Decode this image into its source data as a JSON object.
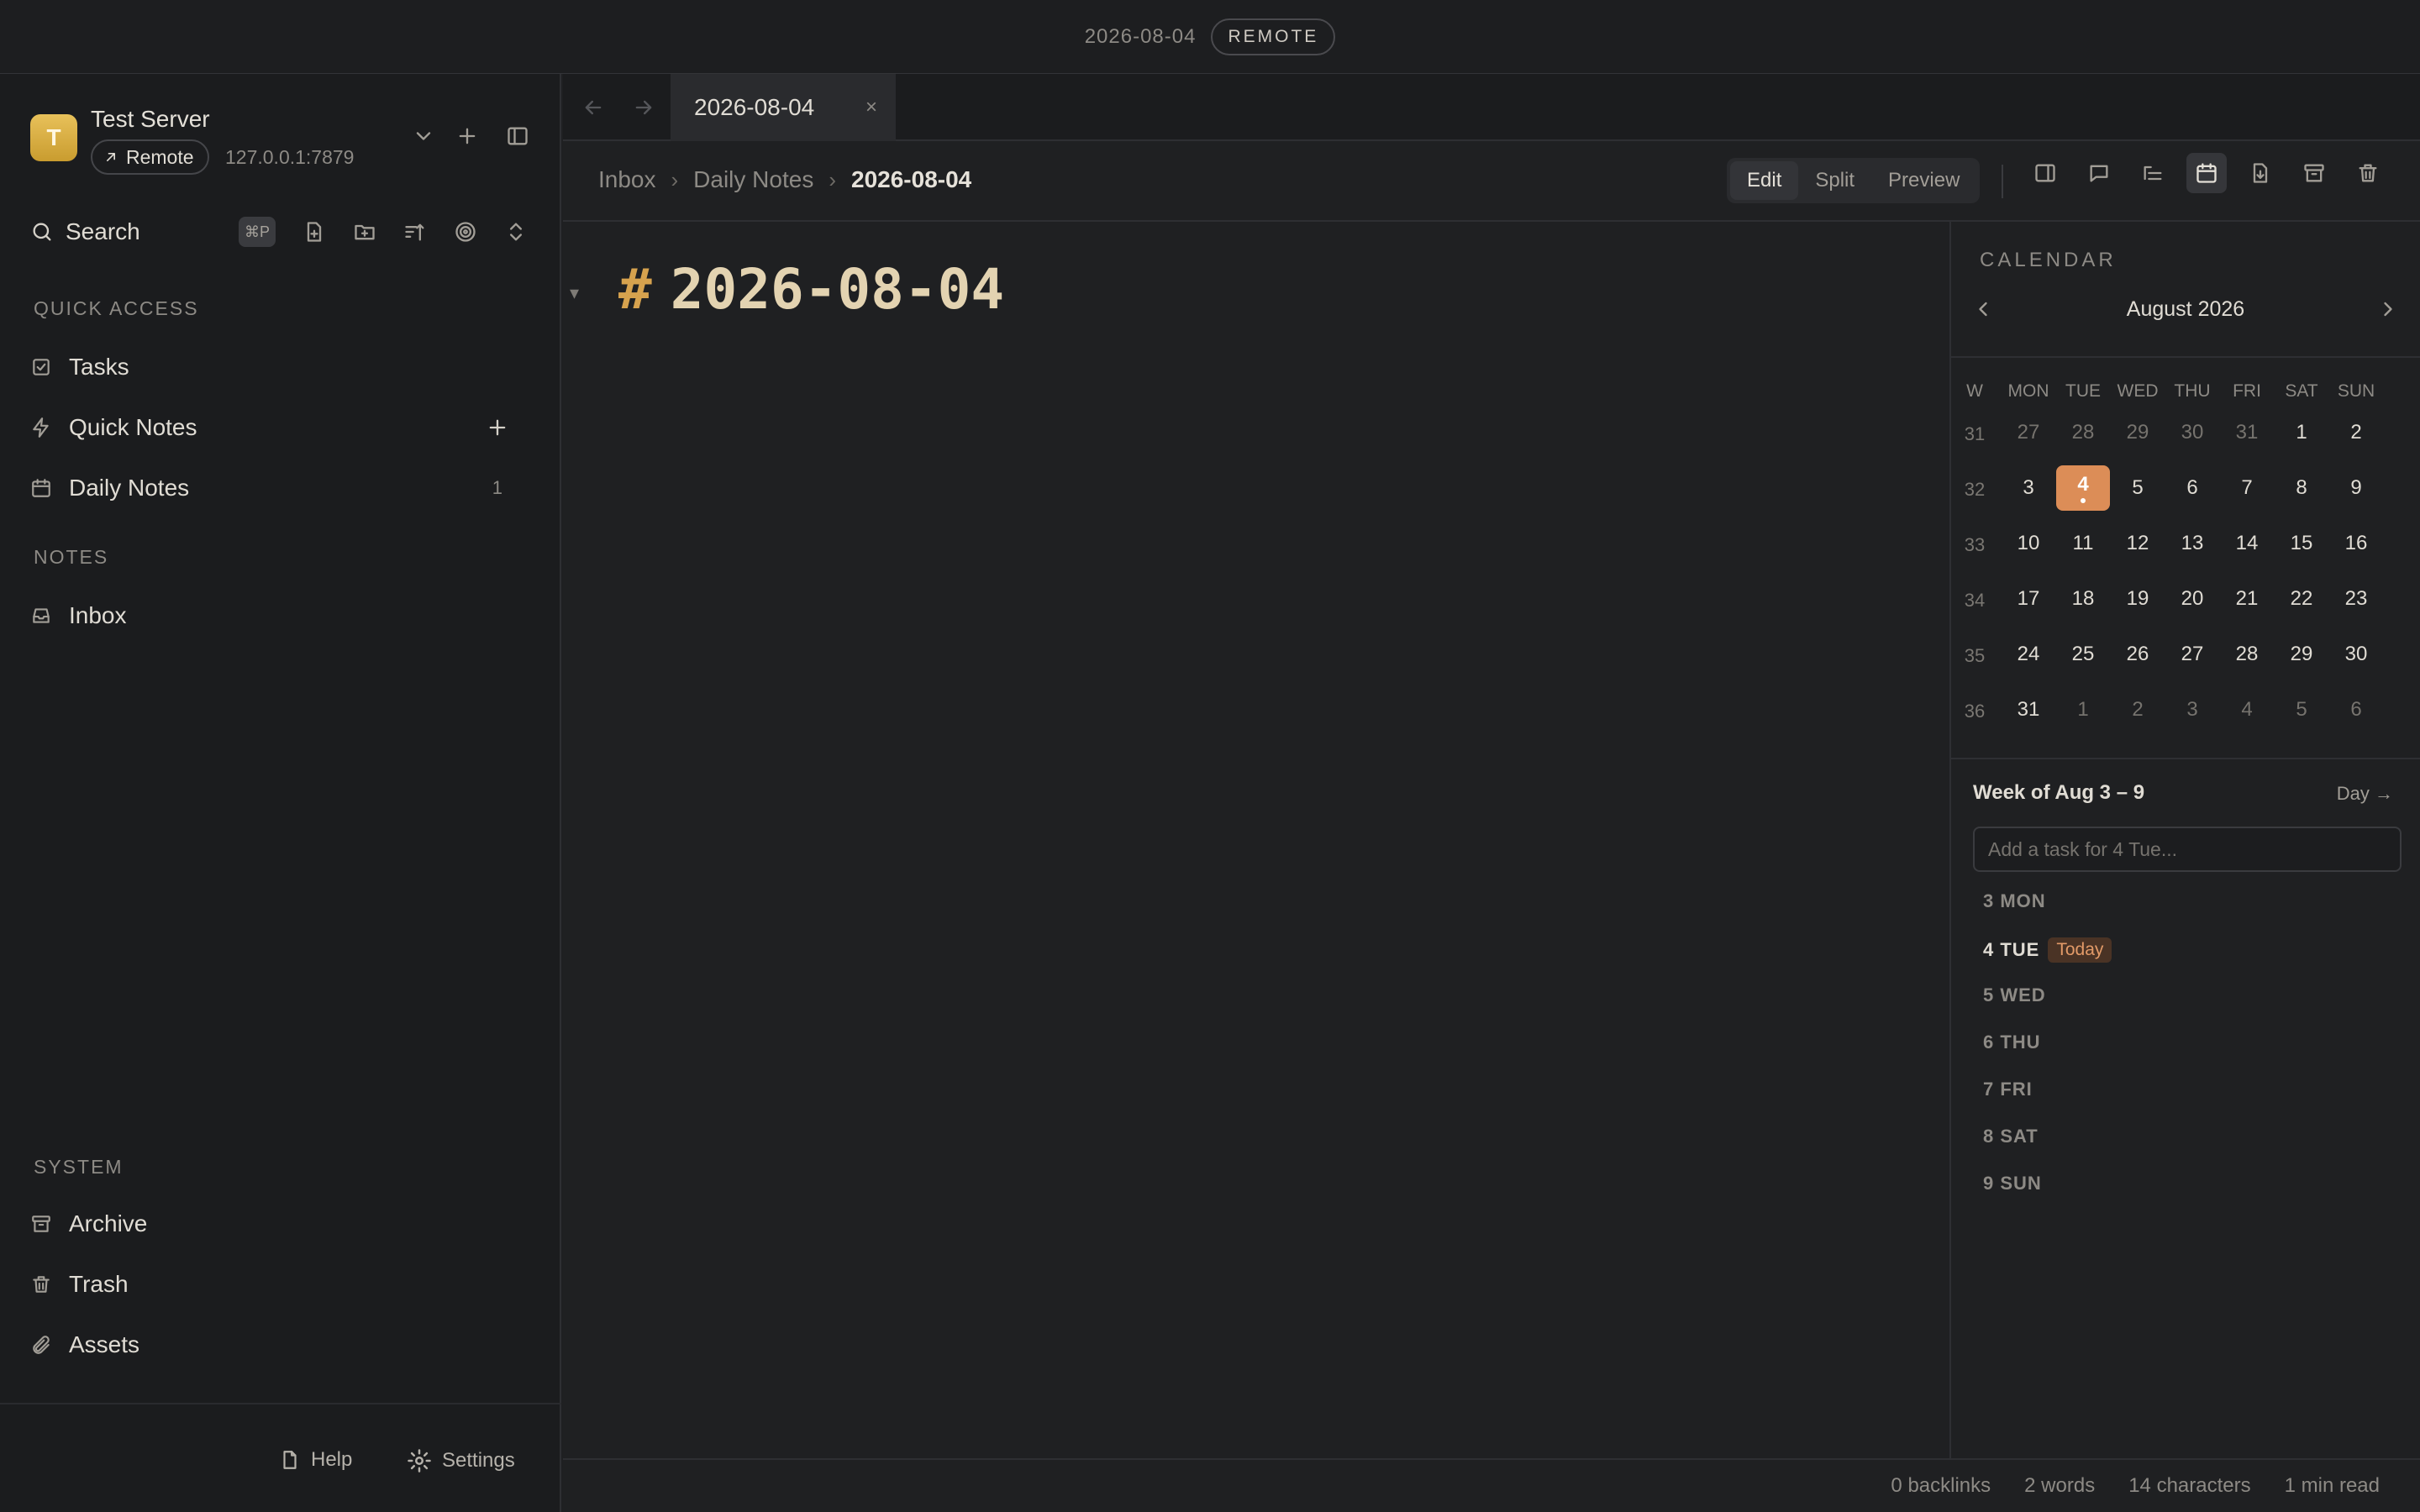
{
  "titlebar": {
    "date": "2026-08-04",
    "mode_badge": "REMOTE"
  },
  "sidebar": {
    "server": {
      "avatar_letter": "T",
      "name": "Test Server",
      "type": "Remote",
      "address": "127.0.0.1:7879"
    },
    "search": {
      "label": "Search",
      "shortcut": "⌘P"
    },
    "quick_access_title": "QUICK ACCESS",
    "quick_access": [
      {
        "label": "Tasks",
        "icon": "task-check-icon"
      },
      {
        "label": "Quick Notes",
        "icon": "lightning-icon"
      },
      {
        "label": "Daily Notes",
        "icon": "calendar-icon",
        "count": "1"
      }
    ],
    "notes_title": "NOTES",
    "notes": [
      {
        "label": "Inbox",
        "icon": "inbox-icon"
      }
    ],
    "system_title": "SYSTEM",
    "system": [
      {
        "label": "Archive",
        "icon": "archive-icon"
      },
      {
        "label": "Trash",
        "icon": "trash-icon"
      },
      {
        "label": "Assets",
        "icon": "paperclip-icon"
      }
    ],
    "footer": {
      "help": "Help",
      "settings": "Settings"
    }
  },
  "tabs": [
    {
      "label": "2026-08-04",
      "close": "×"
    }
  ],
  "breadcrumb": {
    "items": [
      "Inbox",
      "Daily Notes"
    ],
    "current": "2026-08-04",
    "separator": "›"
  },
  "view_modes": {
    "edit": "Edit",
    "split": "Split",
    "preview": "Preview",
    "active": "Edit"
  },
  "editor": {
    "heading_marker": "#",
    "heading_text": "2026-08-04",
    "fold_marker": "▾"
  },
  "calendar": {
    "title": "CALENDAR",
    "month": "August 2026",
    "week_label": "W",
    "weekdays": [
      "MON",
      "TUE",
      "WED",
      "THU",
      "FRI",
      "SAT",
      "SUN"
    ],
    "weeks": [
      {
        "num": "31",
        "days": [
          "27",
          "28",
          "29",
          "30",
          "31",
          "1",
          "2"
        ],
        "muted": [
          true,
          true,
          true,
          true,
          true,
          false,
          false
        ]
      },
      {
        "num": "32",
        "days": [
          "3",
          "4",
          "5",
          "6",
          "7",
          "8",
          "9"
        ],
        "muted": [
          false,
          false,
          false,
          false,
          false,
          false,
          false
        ]
      },
      {
        "num": "33",
        "days": [
          "10",
          "11",
          "12",
          "13",
          "14",
          "15",
          "16"
        ],
        "muted": [
          false,
          false,
          false,
          false,
          false,
          false,
          false
        ]
      },
      {
        "num": "34",
        "days": [
          "17",
          "18",
          "19",
          "20",
          "21",
          "22",
          "23"
        ],
        "muted": [
          false,
          false,
          false,
          false,
          false,
          false,
          false
        ]
      },
      {
        "num": "35",
        "days": [
          "24",
          "25",
          "26",
          "27",
          "28",
          "29",
          "30"
        ],
        "muted": [
          false,
          false,
          false,
          false,
          false,
          false,
          false
        ]
      },
      {
        "num": "36",
        "days": [
          "31",
          "1",
          "2",
          "3",
          "4",
          "5",
          "6"
        ],
        "muted": [
          false,
          true,
          true,
          true,
          true,
          true,
          true
        ]
      }
    ],
    "today_label": "4",
    "accent": "#dc8d57",
    "week_title": "Week of Aug 3 – 9",
    "day_link": "Day →",
    "task_placeholder": "Add a task for 4 Tue...",
    "week_days": [
      "3 MON",
      "4 TUE",
      "5 WED",
      "6 THU",
      "7 FRI",
      "8 SAT",
      "9 SUN"
    ],
    "today_badge": "Today"
  },
  "statusbar": {
    "backlinks": "0 backlinks",
    "words": "2 words",
    "characters": "14 characters",
    "read_time": "1 min read"
  }
}
